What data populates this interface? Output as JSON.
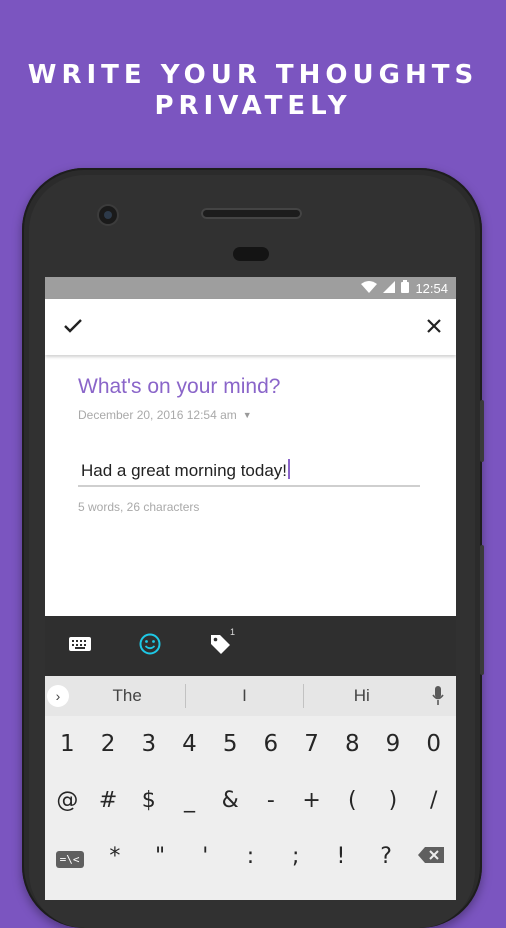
{
  "promo": {
    "line1": "WRITE YOUR THOUGHTS",
    "line2": "PRIVATELY"
  },
  "status_bar": {
    "time": "12:54"
  },
  "app_bar": {
    "confirm_icon": "check-icon",
    "close_icon": "close-icon"
  },
  "entry": {
    "title_placeholder": "What's on your mind?",
    "date": "December 20, 2016 12:54 am",
    "body_text": "Had a great morning today!",
    "stats": "5 words, 26 characters"
  },
  "toolbar": {
    "tag_count": "1",
    "emoji_color": "#1ec8e6"
  },
  "keyboard": {
    "suggestions": [
      "The",
      "I",
      "Hi"
    ],
    "row1": [
      "1",
      "2",
      "3",
      "4",
      "5",
      "6",
      "7",
      "8",
      "9",
      "0"
    ],
    "row2": [
      "@",
      "#",
      "$",
      "_",
      "&",
      "-",
      "+",
      "(",
      ")",
      "/"
    ],
    "row3_switch": "=\\<",
    "row3": [
      "*",
      "\"",
      "'",
      ":",
      ";",
      "!",
      "?"
    ]
  },
  "colors": {
    "background": "#7b55c0",
    "accent": "#8a65c9"
  }
}
